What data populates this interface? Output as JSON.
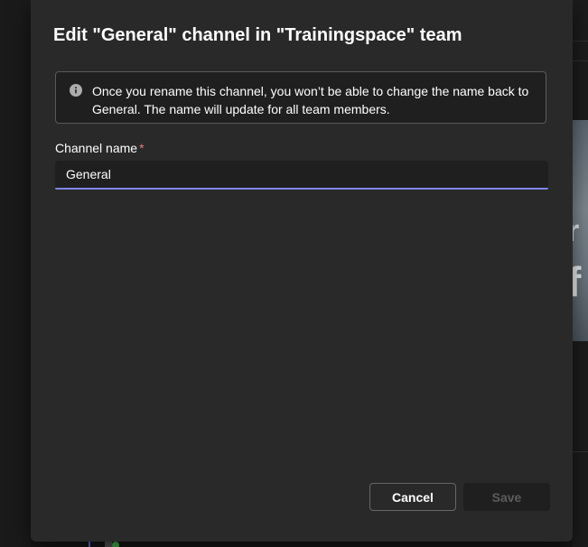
{
  "dialog": {
    "title": "Edit \"General\" channel in \"Trainingspace\" team",
    "info_icon": "info-icon",
    "info_message": "Once you rename this channel, you won’t be able to change the name back to General. The name will update for all team members.",
    "field_label": "Channel name",
    "required_marker": "*",
    "field_value": "General",
    "cancel_label": "Cancel",
    "save_label": "Save",
    "save_enabled": false
  },
  "background": {
    "image_text_line1": "r",
    "image_text_line2": "f"
  },
  "colors": {
    "accent": "#7f85f5",
    "dialog_bg": "#292929",
    "required": "#e37d80"
  }
}
